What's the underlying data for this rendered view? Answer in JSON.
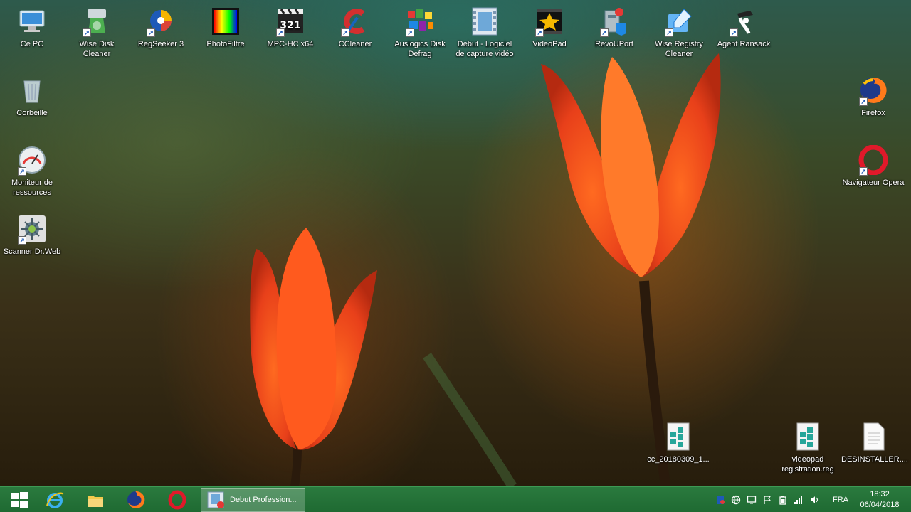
{
  "desktop": {
    "icons": {
      "ce_pc": "Ce PC",
      "wise_disk_cleaner": "Wise Disk Cleaner",
      "regseeker": "RegSeeker 3",
      "photofiltre": "PhotoFiltre",
      "mpc_hc": "MPC-HC x64",
      "ccleaner": "CCleaner",
      "auslogics": "Auslogics Disk Defrag",
      "debut": "Debut - Logiciel de capture vidéo",
      "videopad": "VideoPad",
      "revouport": "RevoUPort",
      "wise_registry": "Wise Registry Cleaner",
      "agent_ransack": "Agent Ransack",
      "corbeille": "Corbeille",
      "moniteur": "Moniteur de ressources",
      "scanner_drweb": "Scanner Dr.Web",
      "firefox": "Firefox",
      "opera": "Navigateur Opera",
      "cc_reg": "cc_20180309_1...",
      "videopad_reg": "videopad registration.reg",
      "desinstaller": "DESINSTALLER...."
    }
  },
  "taskbar": {
    "active_task_label": "Debut Profession...",
    "language": "FRA",
    "time": "18:32",
    "date": "06/04/2018"
  },
  "colors": {
    "taskbar": "#1f6a32",
    "accent": "#2a7a3e"
  }
}
